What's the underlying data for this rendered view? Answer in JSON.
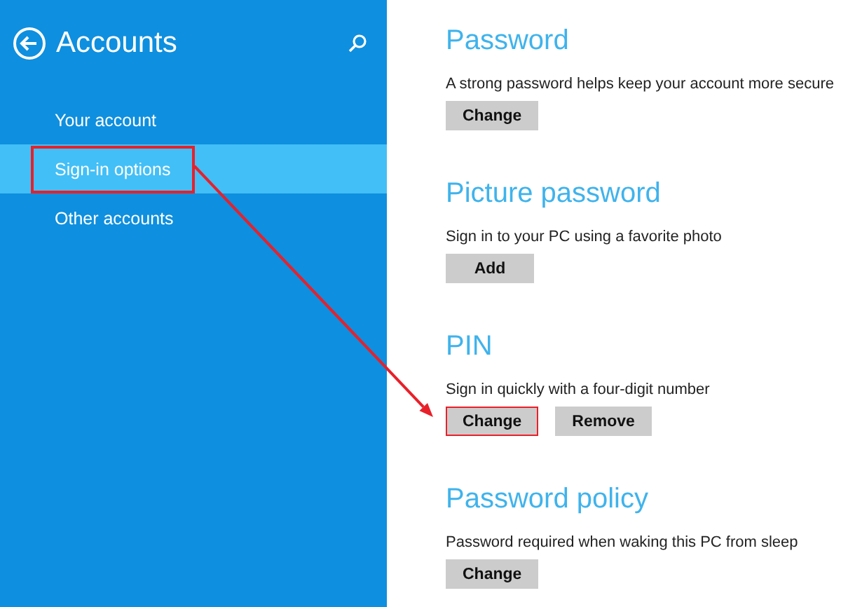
{
  "sidebar": {
    "title": "Accounts",
    "items": [
      {
        "label": "Your account",
        "selected": false,
        "highlighted": false
      },
      {
        "label": "Sign-in options",
        "selected": true,
        "highlighted": true
      },
      {
        "label": "Other accounts",
        "selected": false,
        "highlighted": false
      }
    ]
  },
  "sections": [
    {
      "heading": "Password",
      "description": "A strong password helps keep your account more secure",
      "buttons": [
        {
          "label": "Change",
          "highlighted": false
        }
      ]
    },
    {
      "heading": "Picture password",
      "description": "Sign in to your PC using a favorite photo",
      "buttons": [
        {
          "label": "Add",
          "highlighted": false
        }
      ]
    },
    {
      "heading": "PIN",
      "description": "Sign in quickly with a four-digit number",
      "buttons": [
        {
          "label": "Change",
          "highlighted": true
        },
        {
          "label": "Remove",
          "highlighted": false
        }
      ]
    },
    {
      "heading": "Password policy",
      "description": "Password required when waking this PC from sleep",
      "buttons": [
        {
          "label": "Change",
          "highlighted": false
        }
      ]
    }
  ]
}
